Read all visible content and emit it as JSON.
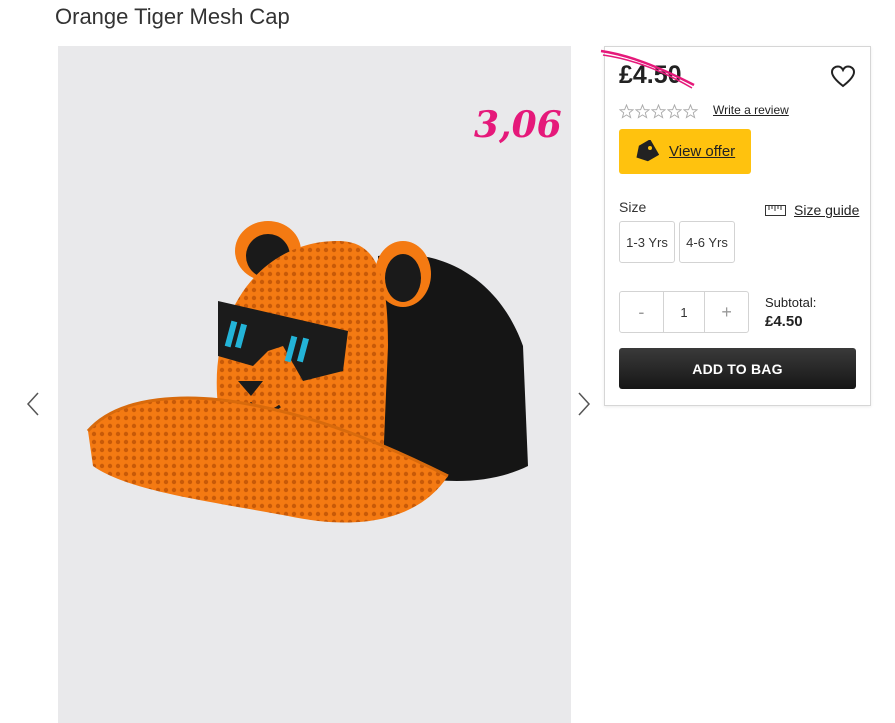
{
  "product": {
    "title": "Orange Tiger Mesh Cap"
  },
  "gallery": {
    "image_name": "orange-tiger-mesh-cap-photo",
    "prev_icon": "chevron-left-icon",
    "next_icon": "chevron-right-icon"
  },
  "annotation": {
    "handwritten_price": "3,06",
    "color": "#e5197a"
  },
  "purchase_panel": {
    "price": "£4.50",
    "wishlist_icon": "heart-icon",
    "rating": {
      "stars_filled": 0,
      "stars_total": 5
    },
    "write_review": "Write a review",
    "offer": {
      "label": "View offer",
      "icon": "tag-icon",
      "color": "#ffc20e"
    },
    "size": {
      "label": "Size",
      "guide_label": "Size guide",
      "guide_icon": "ruler-icon",
      "options": [
        "1-3 Yrs",
        "4-6 Yrs"
      ]
    },
    "quantity": {
      "minus": "-",
      "value": "1",
      "plus": "+"
    },
    "subtotal": {
      "label": "Subtotal:",
      "value": "£4.50"
    },
    "add_to_bag": "ADD TO BAG"
  }
}
